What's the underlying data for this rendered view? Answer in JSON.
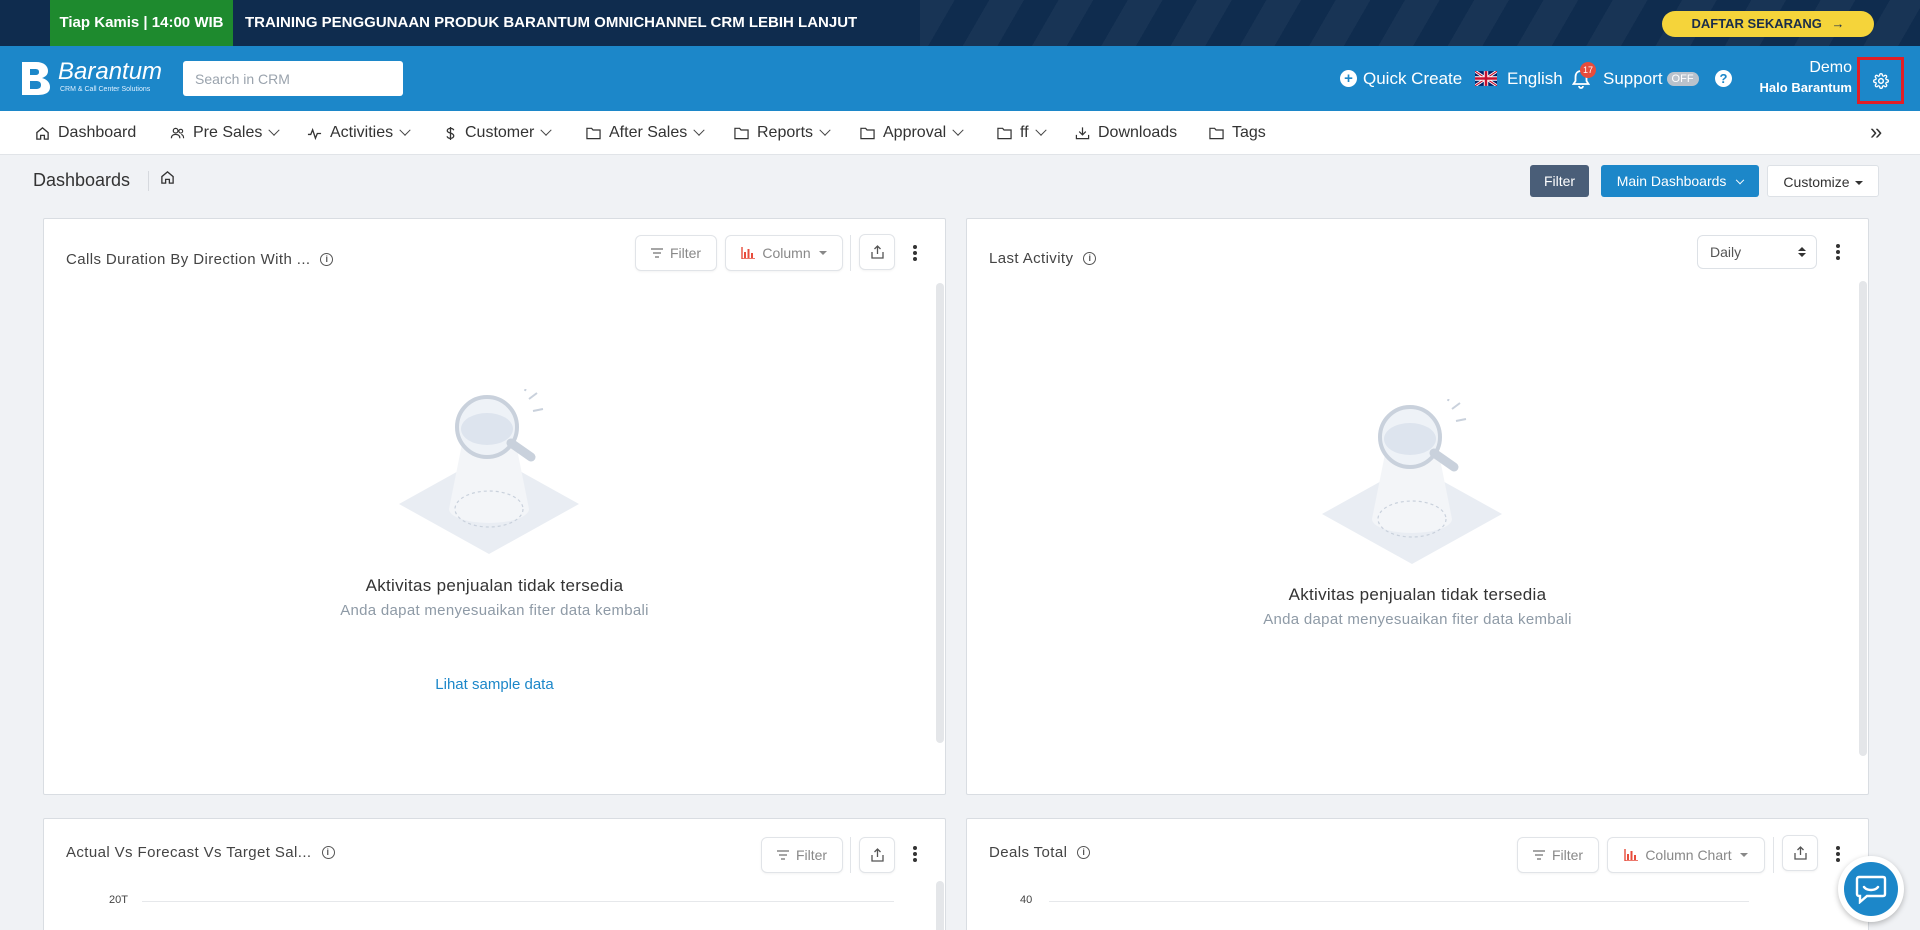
{
  "banner": {
    "date_label": "Tiap Kamis | 14:00 WIB",
    "text": "TRAINING PENGGUNAAN PRODUK BARANTUM OMNICHANNEL CRM LEBIH LANJUT",
    "cta_label": "DAFTAR SEKARANG",
    "cta_arrow": "→"
  },
  "header": {
    "logo_name": "Barantum",
    "logo_subtitle": "CRM & Call Center Solutions",
    "search_placeholder": "Search in CRM",
    "quick_create": "Quick Create",
    "quick_create_icon": "+",
    "language": "English",
    "notification_count": "17",
    "support_label": "Support",
    "support_status": "OFF",
    "help_icon": "?",
    "user_name": "Demo",
    "user_company": "Halo Barantum"
  },
  "nav": {
    "items": [
      {
        "label": "Dashboard",
        "icon": "home-icon"
      },
      {
        "label": "Pre Sales",
        "icon": "users-icon"
      },
      {
        "label": "Activities",
        "icon": "activity-icon"
      },
      {
        "label": "Customer",
        "icon": "dollar-icon"
      },
      {
        "label": "After Sales",
        "icon": "folder-icon"
      },
      {
        "label": "Reports",
        "icon": "folder-icon"
      },
      {
        "label": "Approval",
        "icon": "folder-icon"
      },
      {
        "label": "ff",
        "icon": "folder-icon"
      },
      {
        "label": "Downloads",
        "icon": "download-icon"
      },
      {
        "label": "Tags",
        "icon": "folder-icon"
      }
    ],
    "more": "»"
  },
  "toolbar": {
    "title": "Dashboards",
    "filter_label": "Filter",
    "main_dashboards_label": "Main Dashboards",
    "customize_label": "Customize"
  },
  "cards": {
    "calls": {
      "title": "Calls Duration By Direction With ...",
      "filter_label": "Filter",
      "chart_type_label": "Column",
      "empty_title": "Aktivitas penjualan tidak tersedia",
      "empty_subtitle": "Anda dapat menyesuaikan fiter data kembali",
      "sample_link": "Lihat sample data"
    },
    "last_activity": {
      "title": "Last Activity",
      "period_label": "Daily",
      "empty_title": "Aktivitas penjualan tidak tersedia",
      "empty_subtitle": "Anda dapat menyesuaikan fiter data kembali"
    },
    "forecast": {
      "title": "Actual Vs Forecast Vs Target Sal...",
      "filter_label": "Filter",
      "y_top_tick": "20T"
    },
    "deals": {
      "title": "Deals Total",
      "filter_label": "Filter",
      "chart_type_label": "Column Chart",
      "y_top_tick": "40"
    }
  },
  "colors": {
    "brand": "#1c87c9",
    "banner_bg": "#0f2c4e",
    "banner_date_bg": "#1e8a2e",
    "cta_bg": "#f5d43a",
    "highlight": "#e21e25"
  }
}
